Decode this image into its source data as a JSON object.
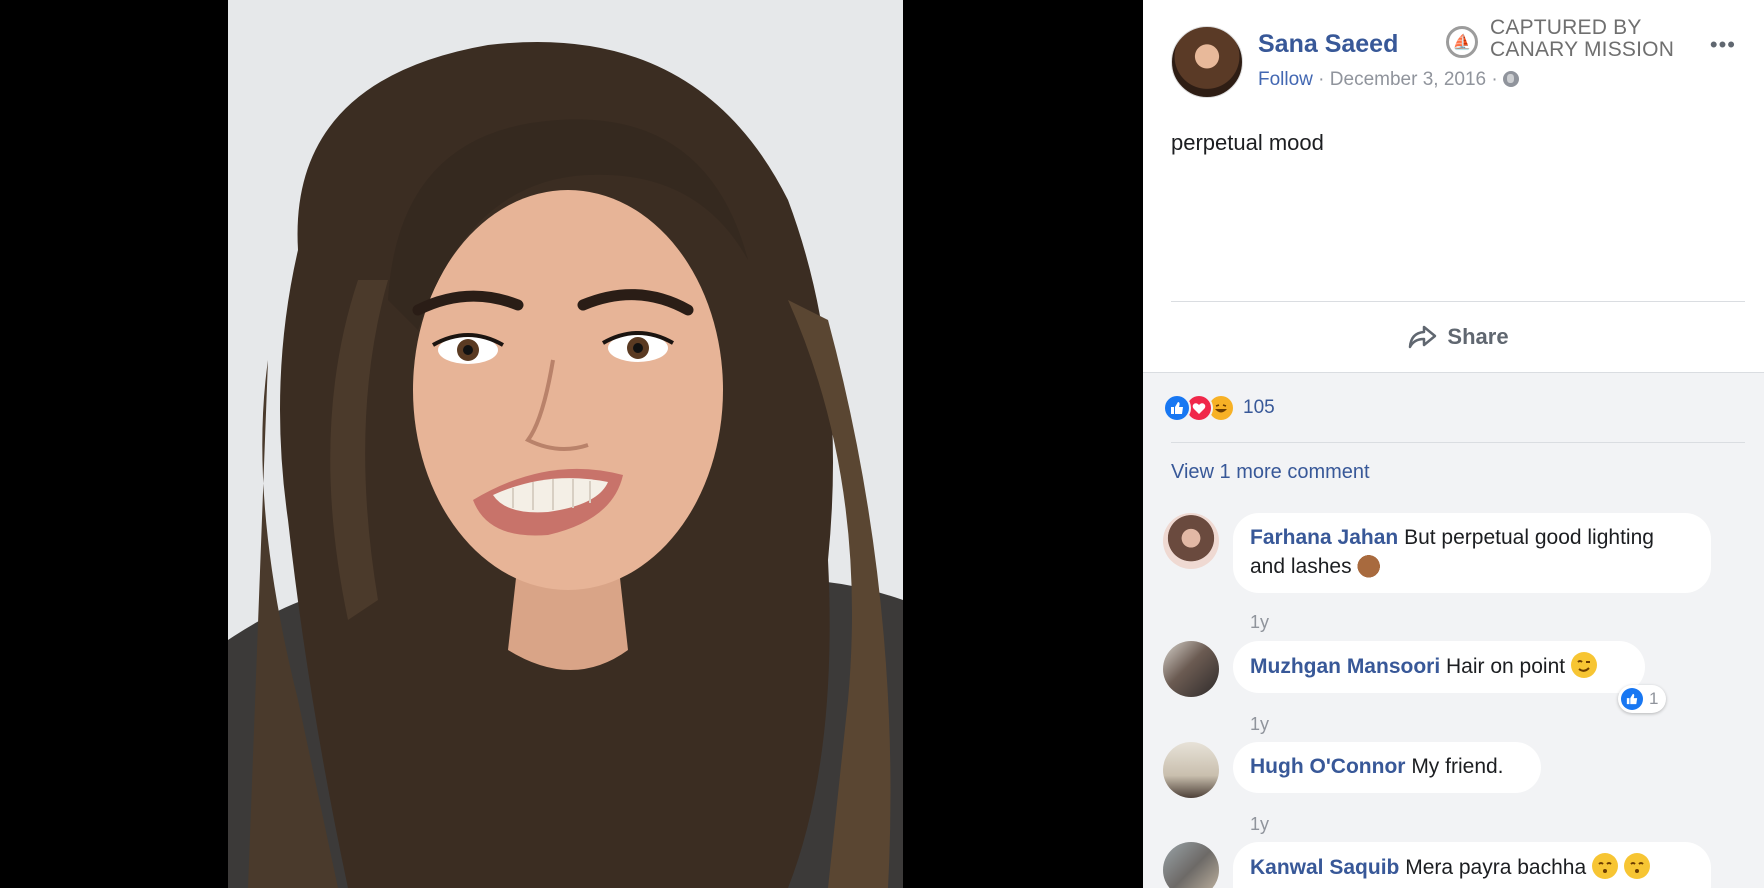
{
  "photo": {
    "alt_icon": "selfie-photo"
  },
  "post": {
    "author": "Sana Saeed",
    "watermark_line1": "CAPTURED BY",
    "watermark_line2": "CANARY MISSION",
    "follow_label": "Follow",
    "separator": " · ",
    "date": "December 3, 2016",
    "more_label": "•••",
    "text": "perpetual mood",
    "share_label": "Share"
  },
  "reactions": {
    "types": [
      "like-icon",
      "love-icon",
      "haha-icon"
    ],
    "count": "105"
  },
  "view_more_label": "View 1 more comment",
  "comments": [
    {
      "name": "Farhana Jahan",
      "text": "But perpetual good lighting and lashes",
      "emoji": "ok-hand-icon",
      "time": "1y"
    },
    {
      "name": "Muzhgan Mansoori",
      "text": "Hair on point",
      "emoji": "wink-icon",
      "time": "1y",
      "likes": "1"
    },
    {
      "name": "Hugh O'Connor",
      "text": "My friend.",
      "time": "1y"
    },
    {
      "name": "Kanwal Saquib",
      "text": "Mera payra bachha",
      "emoji": "kiss-icon"
    }
  ],
  "colors": {
    "link": "#385898",
    "meta": "#90949c",
    "feedback_bg": "#f2f3f5",
    "like_blue": "#1877f2",
    "love_red": "#f0284a"
  }
}
